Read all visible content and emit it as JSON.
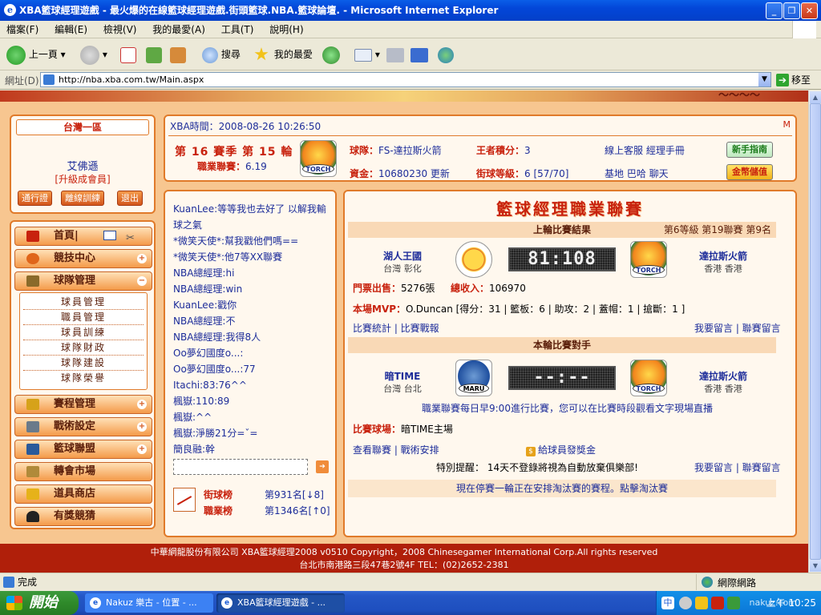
{
  "window": {
    "title": "XBA籃球經理遊戲 - 最火爆的在線籃球經理遊戲.街頭籃球.NBA.籃球論壇. - Microsoft Internet Explorer",
    "controls": [
      "_",
      "❐",
      "✕"
    ]
  },
  "menubar": {
    "items": [
      "檔案(F)",
      "編輯(E)",
      "檢視(V)",
      "我的最愛(A)",
      "工具(T)",
      "說明(H)"
    ]
  },
  "toolbar": {
    "back": "上一頁",
    "search": "搜尋",
    "favorites": "我的最愛"
  },
  "addressbar": {
    "label": "網址(D)",
    "url": "http://nba.xba.com.tw/Main.aspx",
    "go": "移至"
  },
  "left_panel": {
    "region": "台灣一區",
    "username": "艾佛遜",
    "level": "[升級成會員]",
    "buttons": [
      "通行證",
      "離線訓練",
      "退出"
    ]
  },
  "nav": {
    "home": "首頁|",
    "items": [
      "競技中心",
      "球隊管理",
      "賽程管理",
      "戰術設定",
      "籃球聯盟",
      "轉會市場",
      "道具商店",
      "有獎競猜"
    ],
    "submenu": [
      "球員管理",
      "職員管理",
      "球員訓練",
      "球隊財政",
      "球隊建設",
      "球隊榮譽"
    ]
  },
  "top_panel": {
    "time_label": "XBA時間：2008-08-26 10:26:50",
    "m_mark": "M",
    "season": "第 16 賽季  第 15 輪",
    "rating_label": "職業聯賽：",
    "rating_value": "6.19",
    "team_label": "球隊：",
    "team_value": "FS-達拉斯火箭",
    "king_label": "王者積分：",
    "king_value": "3",
    "links1": "線上客服  經理手冊",
    "fund_label": "資金：",
    "fund_value": "10680230",
    "refresh": "更新",
    "grade_label": "街球等級：",
    "grade_value": "6 [57/70]",
    "links2": "基地  巴哈  聊天",
    "guide": "新手指南",
    "topup": "金幣儲值",
    "logo_text": "TORCH"
  },
  "chat": {
    "messages": [
      "KuanLee:等等我也去好了 以解我輸球之氣",
      "*微笑天使*:幫我戳他們嗎==",
      "*微笑天使*:他7等XX聯賽",
      "NBA總經理:hi",
      "NBA總經理:win",
      "KuanLee:戳你",
      "NBA總經理:不",
      "NBA總經理:我得8人",
      "Oo夢幻國度o...:",
      "Oo夢幻國度o...:77",
      "Itachi:83:76^^",
      "楓嶽:110:89",
      "楓嶽:^^",
      "楓嶽:淨勝21分=ˇ=",
      "簡良融:幹"
    ],
    "send": "➔",
    "street_rank_label": "街球榜",
    "street_rank_value": "第931名[↓8]",
    "pro_rank_label": "職業榜",
    "pro_rank_value": "第1346名[↑0]"
  },
  "main": {
    "title": "籃球經理職業聯賽",
    "last_result_header": "上輪比賽結果",
    "last_result_meta": "第6等級  第19聯賽  第9名",
    "home_team": "湖人王國",
    "home_loc": "台灣  彰化",
    "score": "81:108",
    "away_team": "達拉斯火箭",
    "away_loc": "香港  香港",
    "ticket_label": "門票出售：",
    "ticket_value": "5276張",
    "income_label": "總收入：",
    "income_value": "106970",
    "mvp_label": "本場MVP：",
    "mvp_value": "O.Duncan  [得分：31 | 籃板：6 | 助攻：2 | 蓋帽：1 | 搶斷：1 ]",
    "stats_links": "比賽統計 | 比賽戰報",
    "comment_links": "我要留言 | 聯賽留言",
    "next_header": "本輪比賽對手",
    "next_home_team": "暗TIME",
    "next_home_loc": "台灣  台北",
    "next_score": "--:--",
    "next_away_team": "達拉斯火箭",
    "next_away_loc": "香港  香港",
    "schedule_note": "職業聯賽每日早9:00進行比賽，您可以在比賽時段觀看文字現場直播",
    "venue_label": "比賽球場：",
    "venue_value": "暗TIME主場",
    "league_links": "查看聯賽 | 戰術安排",
    "bonus": "給球員發獎金",
    "warning": "特別提醒：  14天不登錄將視為自動放棄俱樂部!",
    "comment_links2": "我要留言 | 聯賽留言",
    "notice": "現在停賽一輪正在安排淘汰賽的賽程。點擊淘汰賽",
    "maru_text": "MARU"
  },
  "footer": {
    "line1": "中華網龍股份有限公司  XBA籃球經理2008 v0510      Copyright，2008 Chinesegamer International Corp.All rights reserved",
    "line2": "台北市南港路三段47巷2號4F  TEL：(02)2652-2381"
  },
  "statusbar": {
    "status": "完成",
    "zone": "網際網路"
  },
  "taskbar": {
    "start": "開始",
    "tasks": [
      "Nakuz 樂古 - 位置 - ...",
      "XBA籃球經理遊戲 - ..."
    ],
    "clock": "上午 10:25",
    "watermark": "nakuz.com"
  }
}
